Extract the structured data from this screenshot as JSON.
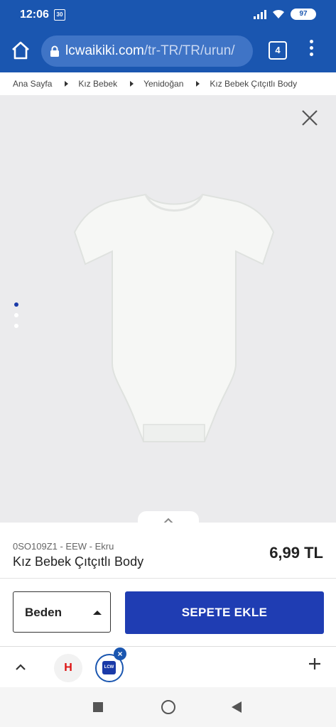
{
  "status_bar": {
    "time": "12:06",
    "notification": "30",
    "battery": "97"
  },
  "browser": {
    "url_host": "lcwaikiki.com",
    "url_path": "/tr-TR/TR/urun/",
    "tab_count": "4"
  },
  "breadcrumb": [
    "Ana Sayfa",
    "Kız Bebek",
    "Yenidoğan",
    "Kız Bebek Çıtçıtlı Body"
  ],
  "gallery": {
    "image_count": 3,
    "active_index": 0
  },
  "product": {
    "sku": "0SO109Z1 - EEW - Ekru",
    "name": "Kız Bebek Çıtçıtlı Body",
    "price": "6,99 TL"
  },
  "actions": {
    "size_label": "Beden",
    "add_to_cart": "SEPETE EKLE"
  },
  "tab_strip": {
    "tab1_label": "H",
    "tab2_logo": "LCW"
  },
  "colors": {
    "brand_blue": "#1a56b0",
    "cart_button": "#1f3db3",
    "gallery_bg": "#ebebed"
  }
}
